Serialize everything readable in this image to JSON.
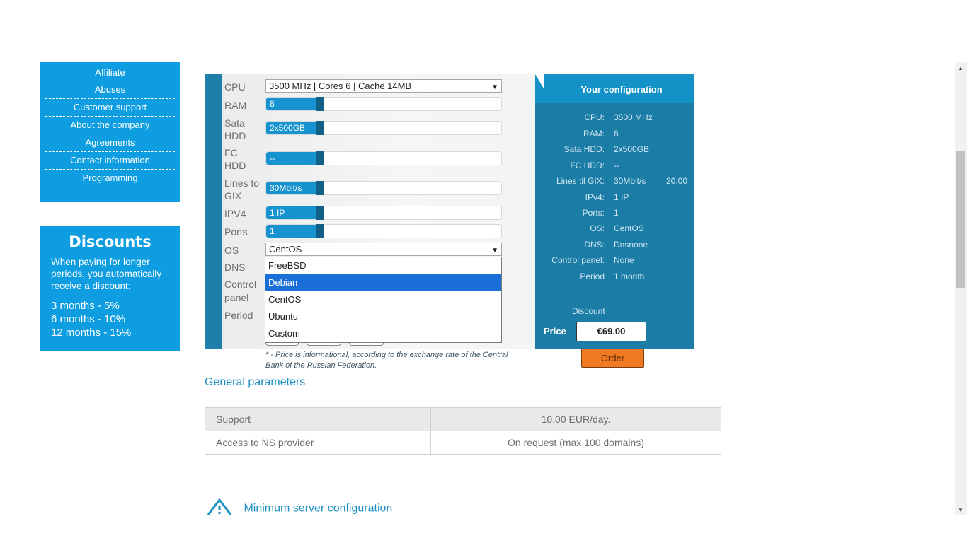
{
  "sidebar": {
    "items": [
      {
        "label": "Affiliate"
      },
      {
        "label": "Abuses"
      },
      {
        "label": "Customer support"
      },
      {
        "label": "About the company"
      },
      {
        "label": "Agreements"
      },
      {
        "label": "Contact information"
      },
      {
        "label": "Programming"
      }
    ]
  },
  "discounts": {
    "title": "Discounts",
    "text": "When paying for longer periods, you automatically receive a discount:",
    "rows": [
      "3 months - 5%",
      "6 months - 10%",
      "12 months - 15%"
    ]
  },
  "config": {
    "labels": {
      "cpu": "CPU",
      "ram": "RAM",
      "sata_hdd_1": "Sata",
      "sata_hdd_2": "HDD",
      "fc_hdd_1": "FC",
      "fc_hdd_2": "HDD",
      "lines_1": "Lines to",
      "lines_2": "GIX",
      "ipv4": "IPV4",
      "ports": "Ports",
      "os": "OS",
      "dns": "DNS",
      "control_1": "Control",
      "control_2": "panel",
      "period": "Period"
    },
    "cpu_select": "3500 MHz | Cores 6 | Cache 14MB",
    "ram_value": "8",
    "sata_value": "2x500GB",
    "fc_value": "--",
    "lines_value": "30Mbit/s",
    "ipv4_value": "1 IP",
    "ports_value": "1",
    "os_select": "CentOS",
    "os_options": [
      "FreeBSD",
      "Debian",
      "CentOS",
      "Ubuntu",
      "Custom"
    ],
    "os_highlighted": "Debian",
    "note": "* - Price is informational, according to the exchange rate of the Central Bank of the Russian Federation."
  },
  "summary": {
    "title": "Your configuration",
    "rows": [
      {
        "k": "CPU:",
        "v": "3500 MHz",
        "x": ""
      },
      {
        "k": "RAM:",
        "v": "8",
        "x": ""
      },
      {
        "k": "Sata HDD:",
        "v": "2x500GB",
        "x": ""
      },
      {
        "k": "FC HDD:",
        "v": "--",
        "x": ""
      },
      {
        "k": "Lines til GIX:",
        "v": "30Mbit/s",
        "x": "20.00"
      },
      {
        "k": "IPv4:",
        "v": "1 IP",
        "x": ""
      },
      {
        "k": "Ports:",
        "v": "1",
        "x": ""
      },
      {
        "k": "OS:",
        "v": "CentOS",
        "x": ""
      },
      {
        "k": "DNS:",
        "v": "Dnsnone",
        "x": ""
      },
      {
        "k": "Control panel:",
        "v": "None",
        "x": ""
      },
      {
        "k": "Period",
        "v": "1 month",
        "x": ""
      }
    ],
    "discount_label": "Discount",
    "price_label": "Price",
    "price_value": "€69.00",
    "order_label": "Order"
  },
  "general": {
    "title": "General parameters",
    "rows": [
      {
        "k": "Support",
        "v": "10.00 EUR/day."
      },
      {
        "k": "Access to NS provider",
        "v": "On request (max 100 domains)"
      }
    ]
  },
  "min_config": {
    "label": "Minimum server configuration",
    "icon": "warning-triangle-icon"
  },
  "colors": {
    "brand_blue": "#0d9de0",
    "panel_blue": "#1b7ca6",
    "order_orange": "#ef7a23",
    "link": "#1b8fc4"
  }
}
